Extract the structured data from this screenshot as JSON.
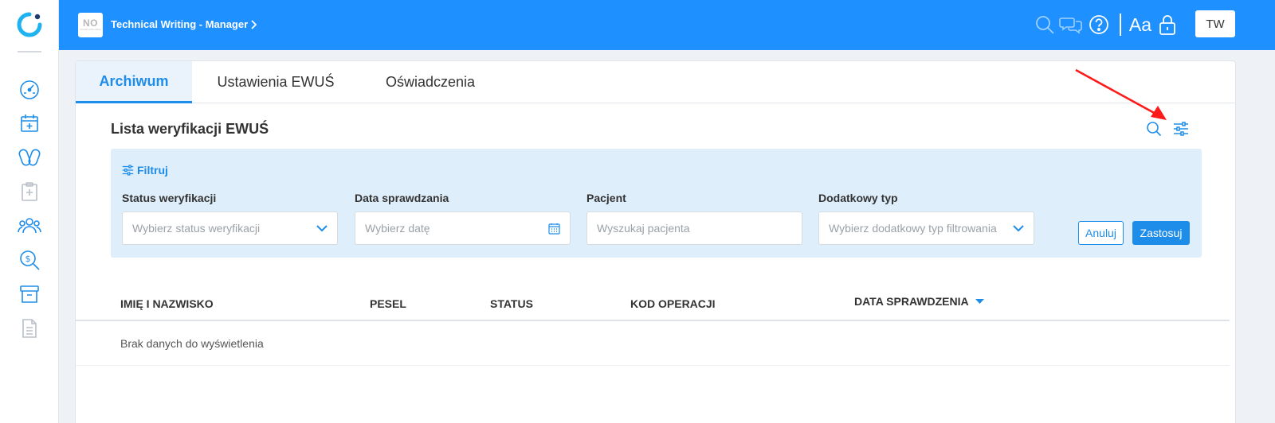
{
  "topbar": {
    "company_logo_text": "NO",
    "company_logo_subtext": "IMAGE AVAILABLE",
    "company_name": "Technical Writing - Manager",
    "font_size_label": "Aa",
    "user_initials": "TW"
  },
  "sidebar": {
    "items": [
      {
        "icon": "dashboard-gauge-icon"
      },
      {
        "icon": "calendar-add-icon"
      },
      {
        "icon": "pills-icon"
      },
      {
        "icon": "clipboard-medical-icon"
      },
      {
        "icon": "users-group-icon"
      },
      {
        "icon": "search-money-icon"
      },
      {
        "icon": "archive-box-icon"
      },
      {
        "icon": "document-icon"
      }
    ]
  },
  "tabs": [
    {
      "label": "Archiwum",
      "active": true
    },
    {
      "label": "Ustawienia EWUŚ",
      "active": false
    },
    {
      "label": "Oświadczenia",
      "active": false
    }
  ],
  "list": {
    "title": "Lista weryfikacji EWUŚ"
  },
  "filter": {
    "heading": "Filtruj",
    "fields": [
      {
        "label": "Status weryfikacji",
        "placeholder": "Wybierz status weryfikacji",
        "icon": "chevron-down-icon"
      },
      {
        "label": "Data sprawdzania",
        "placeholder": "Wybierz datę",
        "icon": "calendar-icon"
      },
      {
        "label": "Pacjent",
        "placeholder": "Wyszukaj pacjenta",
        "icon": ""
      },
      {
        "label": "Dodatkowy typ",
        "placeholder": "Wybierz dodatkowy typ filtrowania",
        "icon": "chevron-down-icon"
      }
    ],
    "cancel_label": "Anuluj",
    "apply_label": "Zastosuj"
  },
  "table": {
    "columns": [
      "IMIĘ I NAZWISKO",
      "PESEL",
      "STATUS",
      "KOD OPERACJI",
      "DATA SPRAWDZENIA"
    ],
    "sorted_column": "DATA SPRAWDZENIA",
    "sort_direction": "desc",
    "empty_message": "Brak danych do wyświetlenia"
  },
  "colors": {
    "primary": "#1e8de9",
    "topbar": "#1e90ff",
    "filter_bg": "#deeefa",
    "annotation_arrow": "#ff1a1a"
  }
}
